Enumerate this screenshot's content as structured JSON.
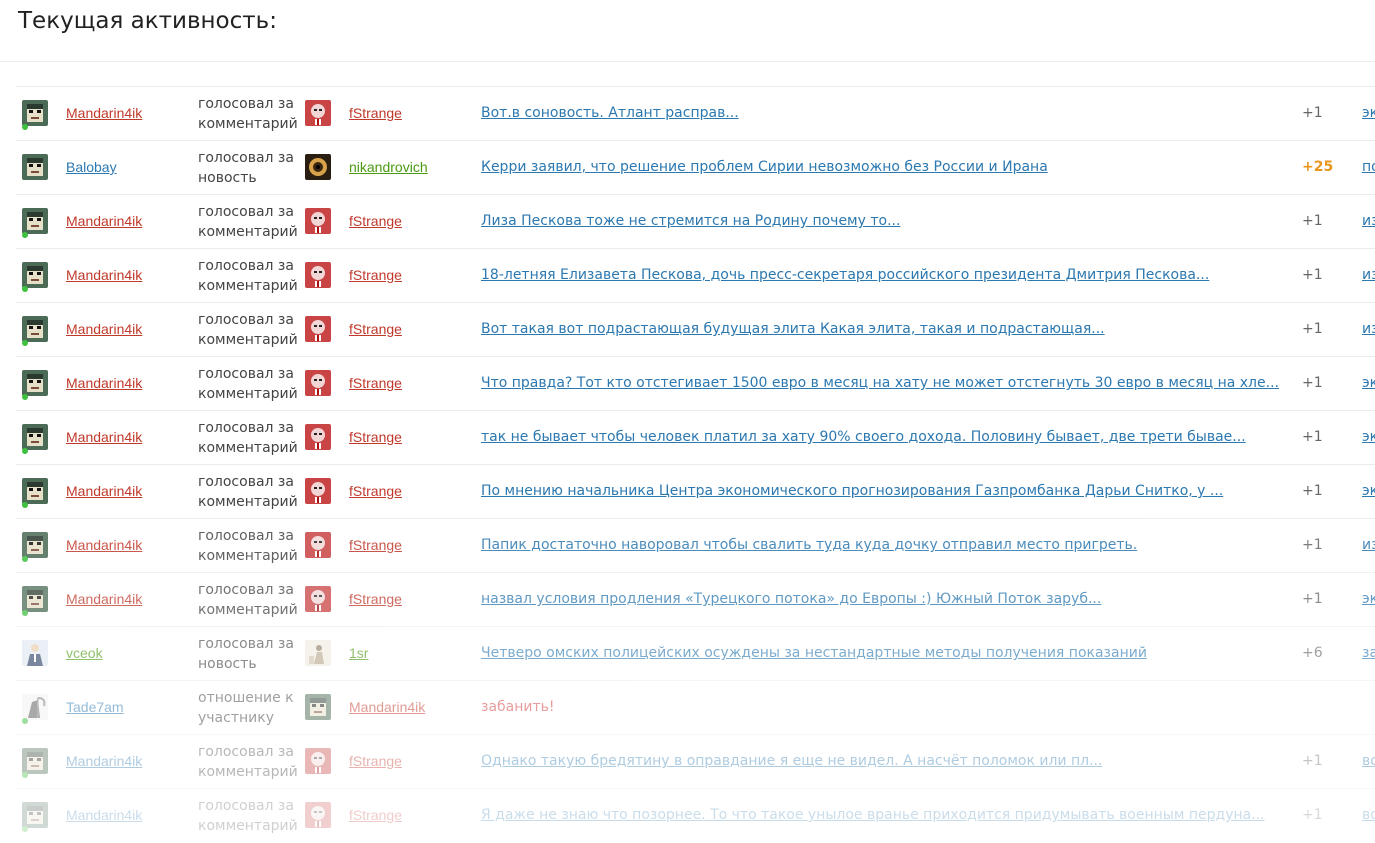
{
  "page": {
    "title": "Текущая активность:"
  },
  "colors": {
    "red_user": "#c0392b",
    "blue_user": "#2c78b0",
    "green_user": "#4b9a13",
    "accent_score": "#e8961e",
    "ban": "#d23a3a"
  },
  "rows": [
    {
      "avatar1": "pixel-face-avatar",
      "user": "Mandarin4ik",
      "user_color": "red",
      "online": true,
      "action": "голосовал за комментарий",
      "avatar2": "red-face-avatar",
      "target": "fStrange",
      "target_color": "red",
      "link": "Вот.в соновость. Атлант расправ...",
      "score": "+1",
      "score_hi": false,
      "extra": "эк"
    },
    {
      "avatar1": "pixel-face-avatar",
      "user": "Balobay",
      "user_color": "blue",
      "online": false,
      "action": "голосовал за новость",
      "avatar2": "eye-avatar",
      "target": "nikandrovich",
      "target_color": "green",
      "link": "Керри заявил, что решение проблем Сирии невозможно без России и Ирана",
      "score": "+25",
      "score_hi": true,
      "extra": "по"
    },
    {
      "avatar1": "pixel-face-avatar",
      "user": "Mandarin4ik",
      "user_color": "red",
      "online": true,
      "action": "голосовал за комментарий",
      "avatar2": "red-face-avatar",
      "target": "fStrange",
      "target_color": "red",
      "link": "Лиза Пескова тоже не стремится на Родину почему то...",
      "score": "+1",
      "score_hi": false,
      "extra": "из"
    },
    {
      "avatar1": "pixel-face-avatar",
      "user": "Mandarin4ik",
      "user_color": "red",
      "online": true,
      "action": "голосовал за комментарий",
      "avatar2": "red-face-avatar",
      "target": "fStrange",
      "target_color": "red",
      "link": "18-летняя Елизавета Пескова, дочь пресс-секретаря российского президента Дмитрия Пескова...",
      "score": "+1",
      "score_hi": false,
      "extra": "из"
    },
    {
      "avatar1": "pixel-face-avatar",
      "user": "Mandarin4ik",
      "user_color": "red",
      "online": true,
      "action": "голосовал за комментарий",
      "avatar2": "red-face-avatar",
      "target": "fStrange",
      "target_color": "red",
      "link": "Вот такая вот подрастающая будущая элита Какая элита, такая и подрастающая...",
      "score": "+1",
      "score_hi": false,
      "extra": "из"
    },
    {
      "avatar1": "pixel-face-avatar",
      "user": "Mandarin4ik",
      "user_color": "red",
      "online": true,
      "action": "голосовал за комментарий",
      "avatar2": "red-face-avatar",
      "target": "fStrange",
      "target_color": "red",
      "link": "Что правда? Тот кто отстегивает 1500 евро в месяц на хату не может отстегнуть 30 евро в месяц на хле...",
      "score": "+1",
      "score_hi": false,
      "extra": "эк"
    },
    {
      "avatar1": "pixel-face-avatar",
      "user": "Mandarin4ik",
      "user_color": "red",
      "online": true,
      "action": "голосовал за комментарий",
      "avatar2": "red-face-avatar",
      "target": "fStrange",
      "target_color": "red",
      "link": "так не бывает чтобы человек платил за хату 90% своего дохода. Половину бывает, две трети бывае...",
      "score": "+1",
      "score_hi": false,
      "extra": "эк"
    },
    {
      "avatar1": "pixel-face-avatar",
      "user": "Mandarin4ik",
      "user_color": "red",
      "online": true,
      "action": "голосовал за комментарий",
      "avatar2": "red-face-avatar",
      "target": "fStrange",
      "target_color": "red",
      "link": "По мнению начальника Центра экономического прогнозирования Газпромбанка Дарьи Снитко, у ...",
      "score": "+1",
      "score_hi": false,
      "extra": "эк"
    },
    {
      "avatar1": "pixel-face-avatar",
      "user": "Mandarin4ik",
      "user_color": "red",
      "online": true,
      "action": "голосовал за комментарий",
      "avatar2": "red-face-avatar",
      "target": "fStrange",
      "target_color": "red",
      "link": "Папик достаточно наворовал чтобы свалить туда куда дочку отправил место пригреть.",
      "score": "+1",
      "score_hi": false,
      "extra": "из"
    },
    {
      "avatar1": "pixel-face-avatar",
      "user": "Mandarin4ik",
      "user_color": "red",
      "online": true,
      "action": "голосовал за комментарий",
      "avatar2": "red-face-avatar",
      "target": "fStrange",
      "target_color": "red",
      "link": "назвал условия продления «Турецкого потока» до Европы :) Южный Поток заруб...",
      "score": "+1",
      "score_hi": false,
      "extra": "эк"
    },
    {
      "avatar1": "suit-man-avatar",
      "user": "vceok",
      "user_color": "green",
      "online": false,
      "action": "голосовал за новость",
      "avatar2": "figure-avatar",
      "target": "1sr",
      "target_color": "green",
      "link": "Четверо омских полицейских осуждены за нестандартные методы получения показаний",
      "score": "+6",
      "score_hi": false,
      "extra": "за"
    },
    {
      "avatar1": "reaper-avatar",
      "user": "Tade7am",
      "user_color": "blue",
      "online": true,
      "action": "отношение к участнику",
      "avatar2": "pixel-face-avatar",
      "target": "Mandarin4ik",
      "target_color": "red",
      "link": "забанить!",
      "link_is_ban": true,
      "score": "",
      "score_hi": false,
      "extra": ""
    },
    {
      "avatar1": "pixel-face-avatar",
      "user": "Mandarin4ik",
      "user_color": "blue",
      "online": true,
      "action": "голосовал за комментарий",
      "avatar2": "red-face-avatar",
      "target": "fStrange",
      "target_color": "red",
      "link": "Однако такую бредятину в оправдание я еще не видел. А насчёт поломок или пл...",
      "score": "+1",
      "score_hi": false,
      "extra": "во"
    },
    {
      "avatar1": "pixel-face-avatar",
      "user": "Mandarin4ik",
      "user_color": "blue",
      "online": true,
      "action": "голосовал за комментарий",
      "avatar2": "red-face-avatar",
      "target": "fStrange",
      "target_color": "red",
      "link": "Я даже не знаю что позорнее. То что такое унылое вранье приходится придумывать военным пердуна...",
      "score": "+1",
      "score_hi": false,
      "extra": "во"
    }
  ]
}
